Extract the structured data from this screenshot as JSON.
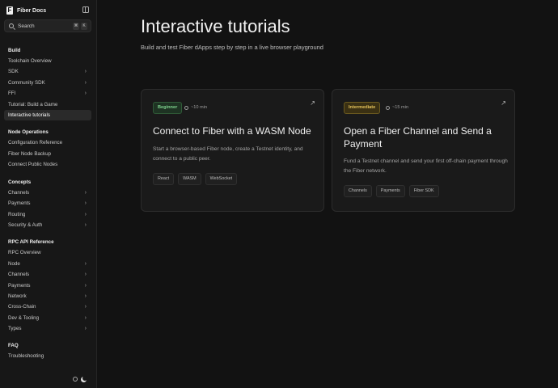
{
  "sidebar": {
    "title": "Fiber Docs",
    "logo_letter": "F",
    "search": {
      "label": "Search",
      "shortcut": [
        "⌘",
        "K"
      ]
    },
    "build_heading": "Build",
    "build_items": [
      {
        "label": "Toolchain Overview",
        "expandable": false
      },
      {
        "label": "SDK",
        "expandable": true
      },
      {
        "label": "Community SDK",
        "expandable": true
      },
      {
        "label": "FFI",
        "expandable": true
      },
      {
        "label": "Tutorial: Build a Game",
        "expandable": false
      },
      {
        "label": "Interactive tutorials",
        "expandable": false,
        "active": true
      }
    ],
    "node_heading": "Node Operations",
    "node_items": [
      {
        "label": "Configuration Reference"
      },
      {
        "label": "Fiber Node Backup"
      },
      {
        "label": "Connect Public Nodes"
      }
    ],
    "concepts_heading": "Concepts",
    "concepts_items": [
      {
        "label": "Channels",
        "expandable": true
      },
      {
        "label": "Payments",
        "expandable": true
      },
      {
        "label": "Routing",
        "expandable": true
      },
      {
        "label": "Security & Auth",
        "expandable": true
      }
    ],
    "rpc_heading": "RPC API Reference",
    "rpc_items": [
      {
        "label": "RPC Overview",
        "expandable": false
      },
      {
        "label": "Node",
        "expandable": true
      },
      {
        "label": "Channels",
        "expandable": true
      },
      {
        "label": "Payments",
        "expandable": true
      },
      {
        "label": "Network",
        "expandable": true
      },
      {
        "label": "Cross-Chain",
        "expandable": true
      },
      {
        "label": "Dev & Tooling",
        "expandable": true
      },
      {
        "label": "Types",
        "expandable": true
      }
    ],
    "faq_heading": "FAQ",
    "faq_items": [
      {
        "label": "Troubleshooting"
      }
    ],
    "chevron_glyph": "›"
  },
  "main": {
    "title": "Interactive tutorials",
    "subtitle": "Build and test Fiber dApps step by step in a live browser playground",
    "cards": [
      {
        "level": "Beginner",
        "duration": "~10 min",
        "title": "Connect to Fiber with a WASM Node",
        "description": "Start a browser-based Fiber node, create a Testnet identity, and connect to a public peer.",
        "tags": [
          "React",
          "WASM",
          "WebSocket"
        ],
        "link_glyph": "↗"
      },
      {
        "level": "Intermediate",
        "duration": "~15 min",
        "title": "Open a Fiber Channel and Send a Payment",
        "description": "Fund a Testnet channel and send your first off-chain payment through the Fiber network.",
        "tags": [
          "Channels",
          "Payments",
          "Fiber SDK"
        ],
        "link_glyph": "↗"
      }
    ]
  },
  "colors": {
    "background": "#121212",
    "sidebar": "#171717",
    "beginner": "#7fd38e",
    "intermediate": "#e4c25a"
  },
  "icons": [
    "panel-toggle-icon",
    "search-icon",
    "chevron-right-icon",
    "clock-icon",
    "external-link-icon",
    "sun-icon",
    "moon-icon"
  ]
}
